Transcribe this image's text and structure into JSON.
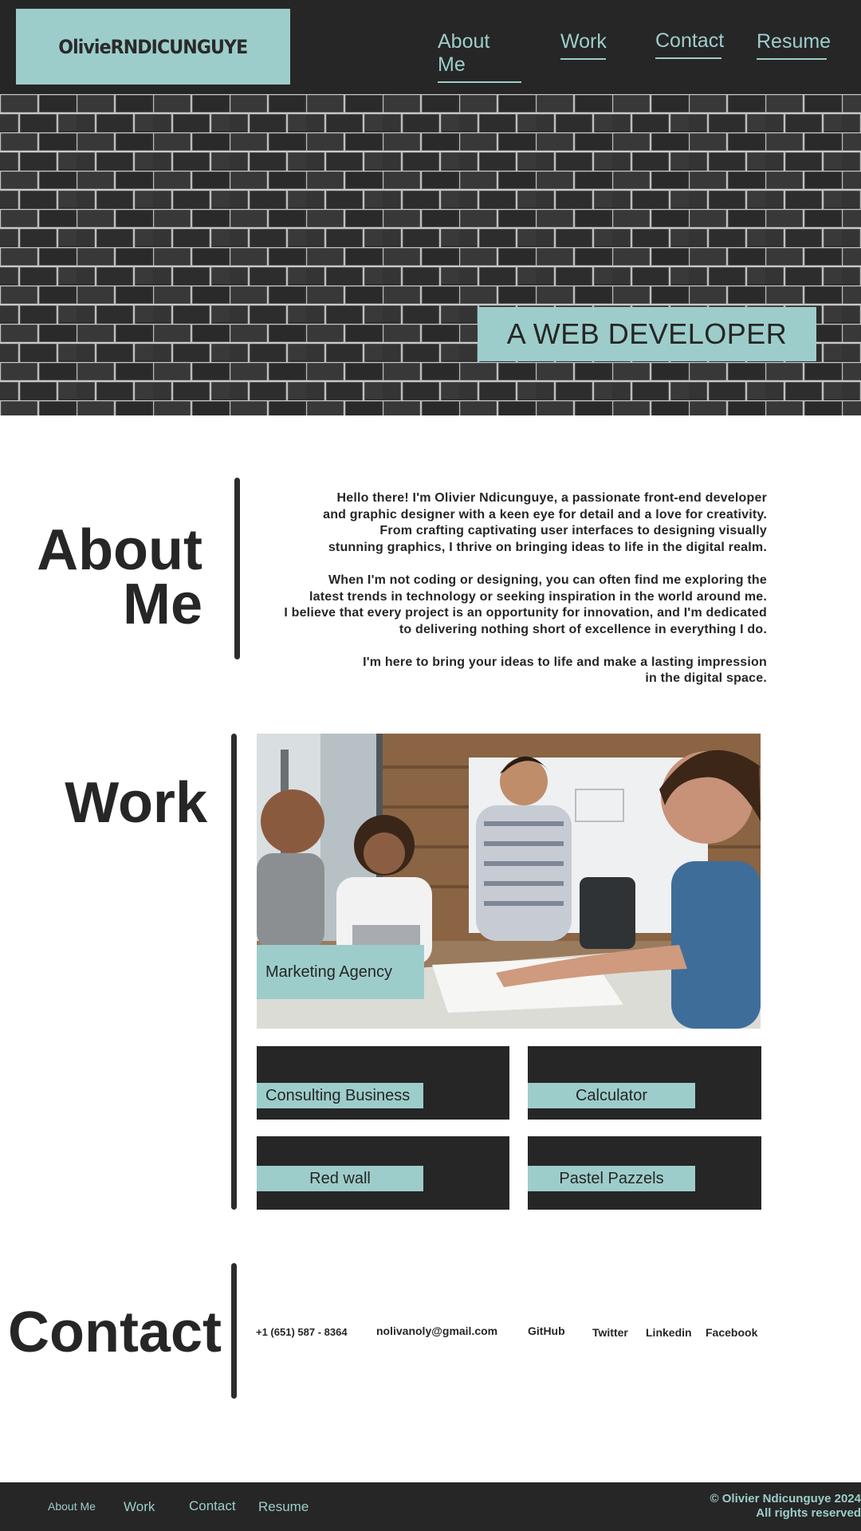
{
  "header": {
    "logo": "OlivieRNDICUNGUYE",
    "nav": [
      "About Me",
      "Work",
      "Contact",
      "Resume"
    ]
  },
  "hero": {
    "badge": "A WEB DEVELOPER"
  },
  "about": {
    "title_line1": "About",
    "title_line2": "Me",
    "paragraphs": [
      [
        "Hello there! I'm Olivier Ndicunguye, a passionate front-end developer",
        "and graphic designer with a keen eye for detail and a love for creativity.",
        "From crafting captivating user interfaces to designing visually",
        "stunning graphics, I thrive on bringing ideas to life in the digital realm."
      ],
      [
        "When I'm not coding or designing, you can often find me exploring the",
        "latest trends in technology or seeking inspiration in the world around me.",
        "I believe that every project is an opportunity for innovation, and I'm dedicated",
        "to delivering nothing short of excellence in everything I do."
      ],
      [
        "I'm here to bring your ideas to life and make a lasting impression",
        "in the digital space."
      ]
    ]
  },
  "work": {
    "title": "Work",
    "featured": "Marketing Agency",
    "projects": [
      "Consulting Business",
      "Calculator",
      "Red wall",
      "Pastel Pazzels"
    ]
  },
  "contact": {
    "title": "Contact",
    "phone": "+1 (651) 587 - 8364",
    "email": "nolivanoly@gmail.com",
    "github": "GitHub",
    "twitter": "Twitter",
    "linkedin": "Linkedin",
    "facebook": "Facebook"
  },
  "footer": {
    "nav": [
      "About Me",
      "Work",
      "Contact",
      "Resume"
    ],
    "copyright_line1": "© Olivier Ndicunguye 2024",
    "copyright_line2": "All rights reserved"
  },
  "colors": {
    "accent": "#9dcdcb",
    "dark": "#262626",
    "background": "#ffffff"
  }
}
